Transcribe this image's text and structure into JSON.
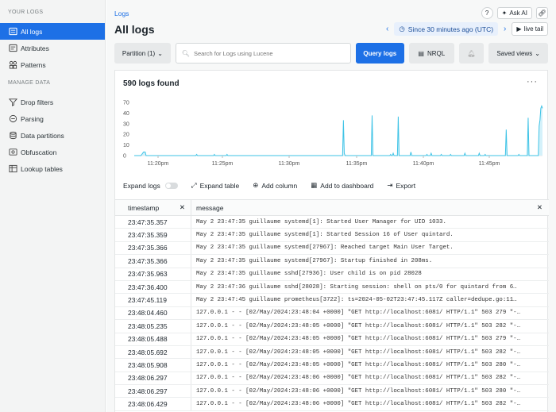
{
  "sidebar": {
    "section1": "YOUR LOGS",
    "items1": [
      {
        "label": "All logs"
      },
      {
        "label": "Attributes"
      },
      {
        "label": "Patterns"
      }
    ],
    "section2": "MANAGE DATA",
    "items2": [
      {
        "label": "Drop filters"
      },
      {
        "label": "Parsing"
      },
      {
        "label": "Data partitions"
      },
      {
        "label": "Obfuscation"
      },
      {
        "label": "Lookup tables"
      }
    ]
  },
  "header": {
    "breadcrumb": "Logs",
    "title": "All logs",
    "help_icon": "?",
    "ask_ai": "Ask AI",
    "time_range": "Since 30 minutes ago (UTC)",
    "live_tail": "live tail"
  },
  "toolbar": {
    "partition": "Partition (1)",
    "search_placeholder": "Search for Logs using Lucene",
    "query": "Query logs",
    "nrql": "NRQL",
    "saved_views": "Saved views"
  },
  "results": {
    "count": "590 logs found"
  },
  "chart_data": {
    "type": "area",
    "y_ticks": [
      "70",
      "40",
      "30",
      "20",
      "10",
      "0"
    ],
    "x_ticks": [
      "11:20pm",
      "11:25pm",
      "11:30pm",
      "11:35pm",
      "11:40pm",
      "11:45pm"
    ],
    "ylim": [
      0,
      70
    ],
    "color": "#3ec3e6",
    "values": [
      0,
      0,
      0,
      0,
      0,
      0,
      0,
      0,
      0,
      1,
      2,
      3,
      3,
      3,
      0,
      0,
      0,
      0,
      0,
      0,
      0,
      0,
      0,
      0,
      0,
      0,
      0,
      0,
      0,
      0,
      0,
      0,
      0,
      0,
      0,
      0,
      0,
      0,
      0,
      0,
      0,
      0,
      0,
      0,
      0,
      0,
      0,
      0,
      0,
      0,
      0,
      0,
      0,
      0,
      0,
      0,
      0,
      0,
      0,
      0,
      0,
      0,
      0,
      0,
      0,
      0,
      0,
      0,
      0,
      0,
      0,
      0,
      0,
      0,
      1,
      0,
      0,
      0,
      0,
      0,
      0,
      0,
      0,
      0,
      0,
      0,
      0,
      0,
      0,
      0,
      0,
      0,
      0,
      0,
      0,
      1,
      0,
      0,
      0,
      0,
      0,
      0,
      0,
      0,
      0,
      0,
      0,
      0,
      0,
      0,
      1,
      0,
      0,
      0,
      0,
      0,
      0,
      0,
      0,
      0,
      0,
      0,
      0,
      0,
      0,
      0,
      0,
      0,
      0,
      0,
      0,
      0,
      0,
      0,
      0,
      0,
      0,
      0,
      0,
      0,
      0,
      0,
      0,
      0,
      0,
      0,
      0,
      0,
      0,
      0,
      0,
      0,
      0,
      0,
      0,
      0,
      0,
      0,
      0,
      0,
      0,
      0,
      0,
      0,
      0,
      0,
      0,
      0,
      0,
      0,
      0,
      0,
      0,
      0,
      0,
      0,
      0,
      0,
      0,
      0,
      0,
      0,
      0,
      0,
      0,
      0,
      0,
      0,
      0,
      0,
      0,
      0,
      0,
      0,
      0,
      0,
      0,
      0,
      0,
      0,
      0,
      0,
      0,
      0,
      0,
      0,
      0,
      0,
      0,
      0,
      0,
      0,
      0,
      0,
      0,
      0,
      0,
      0,
      0,
      0,
      0,
      0,
      0,
      0,
      0,
      0,
      0,
      0,
      0,
      0,
      0,
      0,
      0,
      0,
      0,
      0,
      0,
      0,
      0,
      0,
      0,
      0,
      0,
      0,
      0,
      0,
      0,
      0,
      30,
      2,
      0,
      0,
      0,
      0,
      0,
      0,
      0,
      0,
      0,
      0,
      0,
      0,
      0,
      0,
      0,
      0,
      0,
      0,
      0,
      0,
      0,
      0,
      0,
      0,
      0,
      0,
      0,
      0,
      0,
      0,
      0,
      0,
      34,
      0,
      0,
      0,
      0,
      0,
      0,
      0,
      0,
      0,
      0,
      0,
      0,
      0,
      0,
      0,
      0,
      0,
      0,
      0,
      0,
      0,
      1,
      0,
      0,
      2,
      0,
      0,
      0,
      0,
      0,
      33,
      0,
      0,
      0,
      0,
      0,
      0,
      0,
      0,
      0,
      0,
      0,
      0,
      0,
      0,
      3,
      0,
      0,
      0,
      0,
      0,
      0,
      0,
      0,
      0,
      0,
      0,
      0,
      0,
      0,
      0,
      0,
      0,
      0,
      1,
      0,
      0,
      0,
      0,
      2,
      0,
      0,
      0,
      0,
      0,
      0,
      0,
      0,
      0,
      0,
      0,
      1,
      0,
      0,
      0,
      0,
      0,
      0,
      0,
      0,
      0,
      0,
      1,
      0,
      0,
      0,
      0,
      0,
      0,
      0,
      0,
      0,
      0,
      0,
      0,
      0,
      0,
      0,
      0,
      2,
      0,
      0,
      0,
      0,
      0,
      0,
      0,
      0,
      0,
      0,
      0,
      0,
      0,
      0,
      0,
      0,
      2,
      0,
      0,
      0,
      0,
      0,
      0,
      1,
      0,
      0,
      0,
      0,
      0,
      0,
      0,
      0,
      0,
      0,
      0,
      0,
      0,
      0,
      0,
      0,
      0,
      0,
      0,
      0,
      0,
      0,
      0,
      0,
      22,
      0,
      0,
      0,
      0,
      0,
      0,
      0,
      0,
      0,
      0,
      0,
      0,
      0,
      0,
      1,
      0,
      0,
      0,
      0,
      0,
      0,
      0,
      0,
      0,
      0,
      32,
      0,
      0,
      0,
      0,
      0,
      0,
      0,
      0,
      0,
      0,
      0,
      0,
      25,
      30,
      40,
      42,
      40
    ]
  },
  "actions": {
    "expand_logs": "Expand logs",
    "expand_table": "Expand table",
    "add_column": "Add column",
    "add_dashboard": "Add to dashboard",
    "export": "Export"
  },
  "table": {
    "col_timestamp": "timestamp",
    "col_message": "message",
    "rows": [
      {
        "ts": "23:47:35.357",
        "msg": "May  2 23:47:35 guillaume systemd[1]: Started User Manager for UID 1033."
      },
      {
        "ts": "23:47:35.359",
        "msg": "May  2 23:47:35 guillaume systemd[1]: Started Session 16 of User quintard."
      },
      {
        "ts": "23:47:35.366",
        "msg": "May  2 23:47:35 guillaume systemd[27967]: Reached target Main User Target."
      },
      {
        "ts": "23:47:35.366",
        "msg": "May  2 23:47:35 guillaume systemd[27967]: Startup finished in 208ms."
      },
      {
        "ts": "23:47:35.963",
        "msg": "May  2 23:47:35 guillaume sshd[27936]: User child is on pid 28028"
      },
      {
        "ts": "23:47:36.400",
        "msg": "May  2 23:47:36 guillaume sshd[28028]: Starting session: shell on pts/0 for quintard from 6…"
      },
      {
        "ts": "23:47:45.119",
        "msg": "May  2 23:47:45 guillaume prometheus[3722]: ts=2024-05-02T23:47:45.117Z caller=dedupe.go:11…"
      },
      {
        "ts": "23:48:04.460",
        "msg": "127.0.0.1 - - [02/May/2024:23:48:04 +0000] \"GET http://localhost:6081/ HTTP/1.1\" 503 279 \"-…"
      },
      {
        "ts": "23:48:05.235",
        "msg": "127.0.0.1 - - [02/May/2024:23:48:05 +0000] \"GET http://localhost:6081/ HTTP/1.1\" 503 282 \"-…"
      },
      {
        "ts": "23:48:05.488",
        "msg": "127.0.0.1 - - [02/May/2024:23:48:05 +0000] \"GET http://localhost:6081/ HTTP/1.1\" 503 279 \"-…"
      },
      {
        "ts": "23:48:05.692",
        "msg": "127.0.0.1 - - [02/May/2024:23:48:05 +0000] \"GET http://localhost:6081/ HTTP/1.1\" 503 282 \"-…"
      },
      {
        "ts": "23:48:05.908",
        "msg": "127.0.0.1 - - [02/May/2024:23:48:05 +0000] \"GET http://localhost:6081/ HTTP/1.1\" 503 280 \"-…"
      },
      {
        "ts": "23:48:06.297",
        "msg": "127.0.0.1 - - [02/May/2024:23:48:06 +0000] \"GET http://localhost:6081/ HTTP/1.1\" 503 282 \"-…"
      },
      {
        "ts": "23:48:06.297",
        "msg": "127.0.0.1 - - [02/May/2024:23:48:06 +0000] \"GET http://localhost:6081/ HTTP/1.1\" 503 280 \"-…"
      },
      {
        "ts": "23:48:06.429",
        "msg": "127.0.0.1 - - [02/May/2024:23:48:06 +0000] \"GET http://localhost:6081/ HTTP/1.1\" 503 282 \"-…"
      }
    ]
  }
}
